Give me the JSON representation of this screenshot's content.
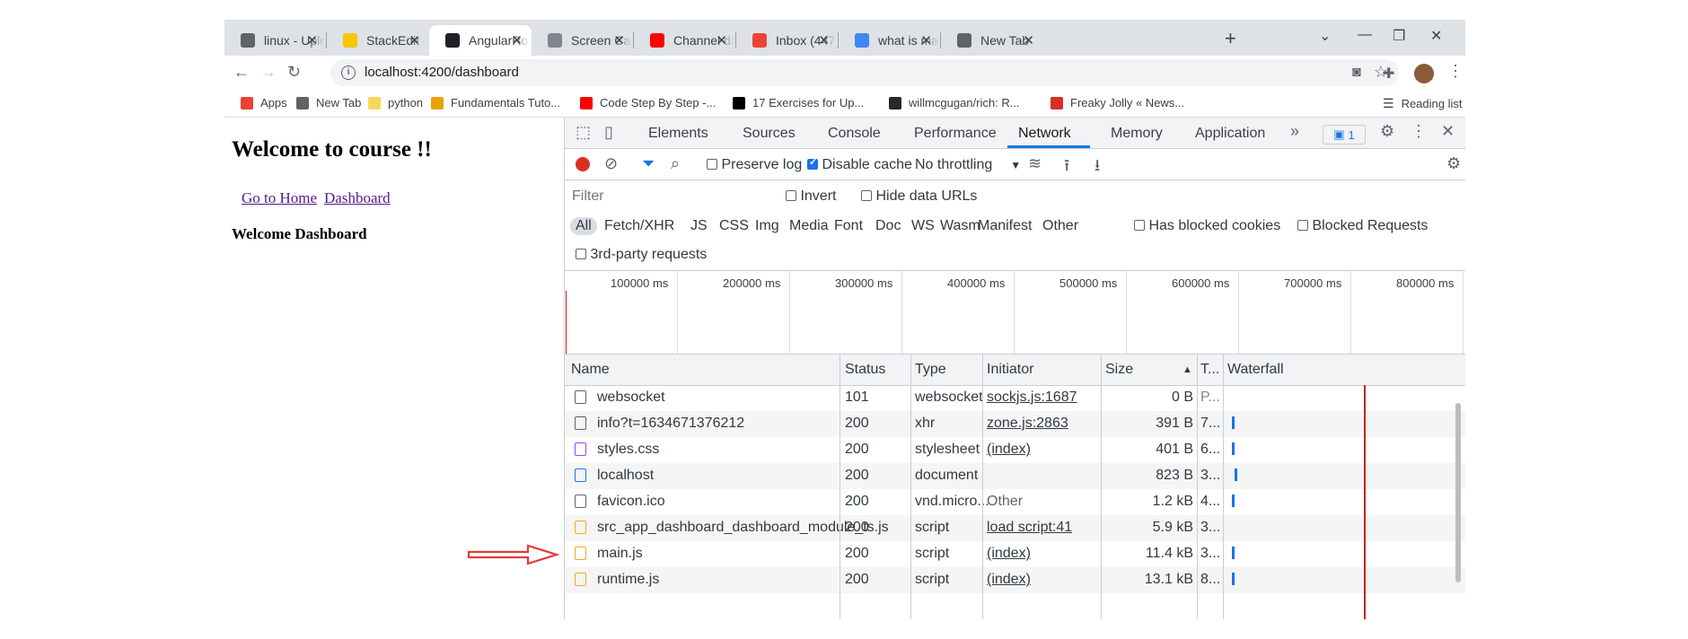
{
  "browser": {
    "tabs": [
      {
        "title": "linux - Uplo",
        "favicon": "upload-icon",
        "color": "#5f6368"
      },
      {
        "title": "StackEdit",
        "favicon": "stackedit-icon",
        "color": "#f7c600"
      },
      {
        "title": "AngularRo",
        "favicon": "angular-icon",
        "color": "#202124",
        "active": true
      },
      {
        "title": "Screen Cap",
        "favicon": "camera-icon",
        "color": "#80868b"
      },
      {
        "title": "Channel da",
        "favicon": "youtube-icon",
        "color": "#ff0000"
      },
      {
        "title": "Inbox (447)",
        "favicon": "gmail-icon",
        "color": "#ea4335"
      },
      {
        "title": "what is mai",
        "favicon": "google-icon",
        "color": "#4285f4"
      },
      {
        "title": "New Tab",
        "favicon": "chrome-icon",
        "color": "#5f6368"
      }
    ],
    "url": "localhost:4200/dashboard",
    "bookmarks": [
      {
        "label": "Apps",
        "color": "#ea4335"
      },
      {
        "label": "New Tab",
        "color": "#5f6368"
      },
      {
        "label": "python",
        "color": "#f9d65c"
      },
      {
        "label": "Fundamentals Tuto...",
        "color": "#e8a400"
      },
      {
        "label": "Code Step By Step -...",
        "color": "#ff0000"
      },
      {
        "label": "17 Exercises for Up...",
        "color": "#000000"
      },
      {
        "label": "willmcgugan/rich: R...",
        "color": "#24292e"
      },
      {
        "label": "Freaky Jolly « News...",
        "color": "#d93025"
      }
    ],
    "reading_list": "Reading list"
  },
  "page": {
    "heading": "Welcome to course !!",
    "links": [
      "Go to Home",
      "Dashboard"
    ],
    "subheading": "Welcome Dashboard"
  },
  "devtools": {
    "tabs": [
      "Elements",
      "Sources",
      "Console",
      "Performance",
      "Network",
      "Memory",
      "Application"
    ],
    "active_tab": "Network",
    "more": "»",
    "badge": "1",
    "toolbar": {
      "preserve_log": "Preserve log",
      "preserve_log_checked": false,
      "disable_cache": "Disable cache",
      "disable_cache_checked": true,
      "throttling": "No throttling"
    },
    "filter_placeholder": "Filter",
    "invert": "Invert",
    "hide_data_urls": "Hide data URLs",
    "types": [
      "All",
      "Fetch/XHR",
      "JS",
      "CSS",
      "Img",
      "Media",
      "Font",
      "Doc",
      "WS",
      "Wasm",
      "Manifest",
      "Other"
    ],
    "has_blocked_cookies": "Has blocked cookies",
    "blocked_requests": "Blocked Requests",
    "third_party": "3rd-party requests",
    "timeline_ticks": [
      "100000 ms",
      "200000 ms",
      "300000 ms",
      "400000 ms",
      "500000 ms",
      "600000 ms",
      "700000 ms",
      "800000 ms"
    ],
    "columns": [
      "Name",
      "Status",
      "Type",
      "Initiator",
      "Size",
      "T...",
      "Waterfall"
    ],
    "sort_indicator": "▲",
    "rows": [
      {
        "name": "websocket",
        "status": "101",
        "type": "websocket",
        "initiator": "sockjs.js:1687",
        "size": "0 B",
        "time": "P...",
        "icon": "file",
        "link": true
      },
      {
        "name": "info?t=1634671376212",
        "status": "200",
        "type": "xhr",
        "initiator": "zone.js:2863",
        "size": "391 B",
        "time": "7...",
        "icon": "file",
        "link": true
      },
      {
        "name": "styles.css",
        "status": "200",
        "type": "stylesheet",
        "initiator": "(index)",
        "size": "401 B",
        "time": "6...",
        "icon": "css",
        "link": true
      },
      {
        "name": "localhost",
        "status": "200",
        "type": "document",
        "initiator": "",
        "size": "823 B",
        "time": "3...",
        "icon": "doc",
        "link": false
      },
      {
        "name": "favicon.ico",
        "status": "200",
        "type": "vnd.micro...",
        "initiator": "Other",
        "size": "1.2 kB",
        "time": "4...",
        "icon": "file",
        "link": false
      },
      {
        "name": "src_app_dashboard_dashboard_module_ts.js",
        "status": "200",
        "type": "script",
        "initiator": "load script:41",
        "size": "5.9 kB",
        "time": "3...",
        "icon": "js",
        "link": true
      },
      {
        "name": "main.js",
        "status": "200",
        "type": "script",
        "initiator": "(index)",
        "size": "11.4 kB",
        "time": "3...",
        "icon": "js",
        "link": true
      },
      {
        "name": "runtime.js",
        "status": "200",
        "type": "script",
        "initiator": "(index)",
        "size": "13.1 kB",
        "time": "8...",
        "icon": "js",
        "link": true
      }
    ]
  },
  "annotation": {
    "arrow_color": "#e53935"
  }
}
